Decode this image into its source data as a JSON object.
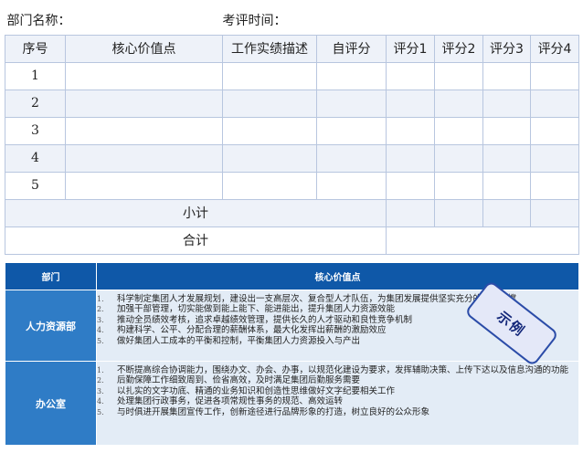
{
  "form": {
    "dept_label": "部门名称：",
    "time_label": "考评时间：",
    "headers": [
      "序号",
      "核心价值点",
      "工作实绩描述",
      "自评分",
      "评分1",
      "评分2",
      "评分3",
      "评分4"
    ],
    "rows": [
      "1",
      "2",
      "3",
      "4",
      "5"
    ],
    "subtotal_label": "小计",
    "total_label": "合计"
  },
  "example": {
    "col_dept": "部门",
    "col_value": "核心价值点",
    "departments": [
      {
        "name": "人力资源部",
        "points": [
          {
            "n": "1.",
            "text": "科学制定集团人才发展规划，建设出一支高层次、复合型人才队伍，为集团发展提供坚实充分的人才支撑"
          },
          {
            "n": "2.",
            "text": "加强干部管理，切实能做到能上能下、能进能出，提升集团人力资源效能"
          },
          {
            "n": "3.",
            "text": "推动全员绩效考核，追求卓越绩效管理，提供长久的人才驱动和良性竞争机制"
          },
          {
            "n": "4.",
            "text": "构建科学、公平、分配合理的薪酬体系，最大化发挥出薪酬的激励效应"
          },
          {
            "n": "5.",
            "text": "做好集团人工成本的平衡和控制，平衡集团人力资源投入与产出"
          }
        ]
      },
      {
        "name": "办公室",
        "points": [
          {
            "n": "1.",
            "text": "不断提高综合协调能力，围绕办文、办会、办事，以规范化建设为要求，发挥辅助决策、上传下达以及信息沟通的功能"
          },
          {
            "n": "2.",
            "text": "后勤保障工作细致周到、俭省高效，及时满足集团后勤服务需要"
          },
          {
            "n": "3.",
            "text": "以扎实的文字功底、精通的业务知识和创造性思维做好文字纪要相关工作"
          },
          {
            "n": "4.",
            "text": "处理集团行政事务，促进各项常规性事务的规范、高效运转"
          },
          {
            "n": "5.",
            "text": "与时俱进开展集团宣传工作，创新途径进行品牌形象的打造，树立良好的公众形象"
          }
        ]
      }
    ]
  },
  "stamp": {
    "label": "示例"
  }
}
